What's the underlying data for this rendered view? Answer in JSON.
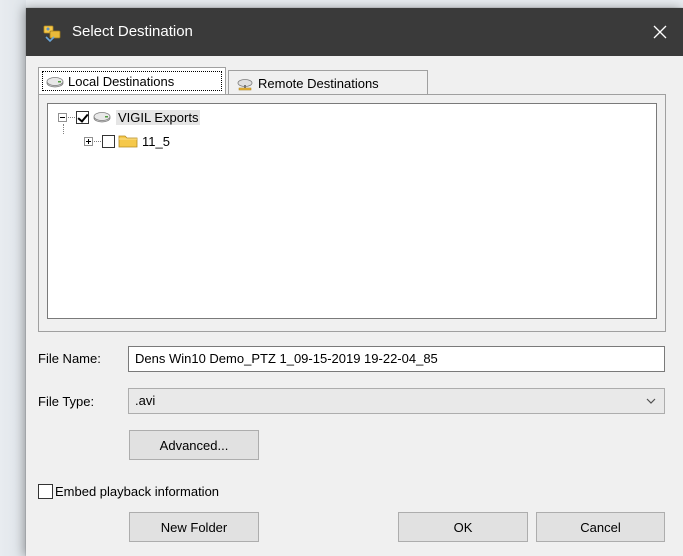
{
  "window": {
    "title": "Select Destination",
    "close_label": "close"
  },
  "tabs": [
    {
      "label": "Local Destinations",
      "active": true
    },
    {
      "label": "Remote Destinations",
      "active": false
    }
  ],
  "tree": {
    "root": {
      "label": "VIGIL Exports",
      "checked": true,
      "expanded": true
    },
    "child": {
      "label": "11_5",
      "checked": false,
      "expanded": false
    }
  },
  "form": {
    "file_name_label": "File Name:",
    "file_name_value": "Dens Win10 Demo_PTZ 1_09-15-2019 19-22-04_85",
    "file_type_label": "File Type:",
    "file_type_value": ".avi",
    "advanced_label": "Advanced...",
    "embed_label": "Embed playback information"
  },
  "buttons": {
    "new_folder": "New Folder",
    "ok": "OK",
    "cancel": "Cancel"
  },
  "colors": {
    "titlebar": "#3a3a3a",
    "dialog_bg": "#f0f0f0",
    "button_bg": "#e1e1e1",
    "folder_yellow": "#f5c84a"
  }
}
